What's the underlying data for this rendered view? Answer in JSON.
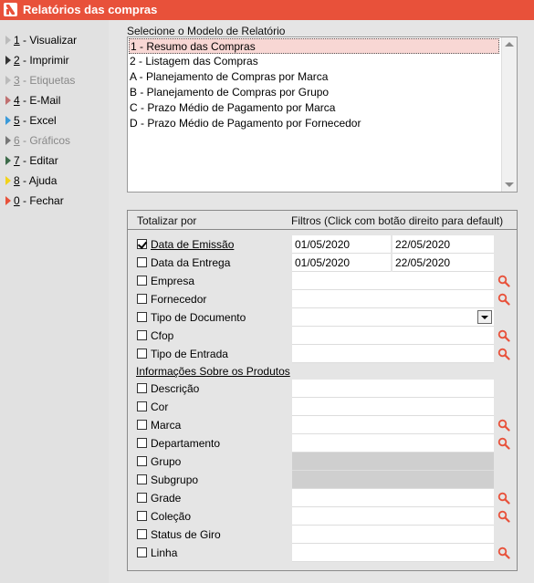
{
  "window": {
    "title": "Relatórios das compras"
  },
  "sidebar": {
    "items": [
      {
        "key": "1",
        "label": " - Visualizar",
        "arrow_color": "#bbbbbb",
        "disabled": false
      },
      {
        "key": "2",
        "label": " - Imprimir",
        "arrow_color": "#333333",
        "disabled": false
      },
      {
        "key": "3",
        "label": " - Etiquetas",
        "arrow_color": "#bbbbbb",
        "disabled": true
      },
      {
        "key": "4",
        "label": " - E-Mail",
        "arrow_color": "#c07070",
        "disabled": false
      },
      {
        "key": "5",
        "label": " - Excel",
        "arrow_color": "#3a9ad9",
        "disabled": false
      },
      {
        "key": "6",
        "label": " - Gráficos",
        "arrow_color": "#777777",
        "disabled": true
      },
      {
        "key": "7",
        "label": " - Editar",
        "arrow_color": "#3d6b4a",
        "disabled": false
      },
      {
        "key": "8",
        "label": " - Ajuda",
        "arrow_color": "#f2d21a",
        "disabled": false
      },
      {
        "key": "0",
        "label": " - Fechar",
        "arrow_color": "#e8513a",
        "disabled": false
      }
    ]
  },
  "report_model": {
    "label": "Selecione o Modelo de Relatório",
    "options": [
      "1 - Resumo das Compras",
      "2 - Listagem das Compras",
      "A - Planejamento de Compras por Marca",
      "B - Planejamento de Compras por Grupo",
      "C - Prazo Médio de Pagamento por Marca",
      "D - Prazo Médio de Pagamento por Fornecedor"
    ],
    "selected_index": 0
  },
  "filters": {
    "totalize_label": "Totalizar por",
    "filters_label": "Filtros (Click com botão direito para default)",
    "rows": [
      {
        "label": "Data de Emissão",
        "checked": true,
        "underline": true,
        "value_from": "01/05/2020",
        "value_to": "22/05/2020",
        "kind": "date"
      },
      {
        "label": "Data da Entrega",
        "checked": false,
        "underline": false,
        "value_from": "01/05/2020",
        "value_to": "22/05/2020",
        "kind": "date"
      },
      {
        "label": "Empresa",
        "checked": false,
        "underline": false,
        "kind": "search"
      },
      {
        "label": "Fornecedor",
        "checked": false,
        "underline": false,
        "kind": "search"
      },
      {
        "label": "Tipo de Documento",
        "checked": false,
        "underline": false,
        "kind": "dropdown"
      },
      {
        "label": "Cfop",
        "checked": false,
        "underline": false,
        "kind": "search"
      },
      {
        "label": "Tipo de Entrada",
        "checked": false,
        "underline": false,
        "kind": "search"
      }
    ],
    "products_heading": "Informações Sobre os Produtos",
    "product_rows": [
      {
        "label": "Descrição",
        "checked": false,
        "kind": "text"
      },
      {
        "label": "Cor",
        "checked": false,
        "kind": "text"
      },
      {
        "label": "Marca",
        "checked": false,
        "kind": "search"
      },
      {
        "label": "Departamento",
        "checked": false,
        "kind": "search"
      },
      {
        "label": "Grupo",
        "checked": false,
        "kind": "disabled"
      },
      {
        "label": "Subgrupo",
        "checked": false,
        "kind": "disabled"
      },
      {
        "label": "Grade",
        "checked": false,
        "kind": "search"
      },
      {
        "label": "Coleção",
        "checked": false,
        "kind": "search"
      },
      {
        "label": "Status de Giro",
        "checked": false,
        "kind": "text"
      },
      {
        "label": "Linha",
        "checked": false,
        "kind": "search"
      }
    ]
  },
  "colors": {
    "accent": "#e8513a",
    "selected_row": "#f8d7d4",
    "magnifier": "#e8513a"
  }
}
